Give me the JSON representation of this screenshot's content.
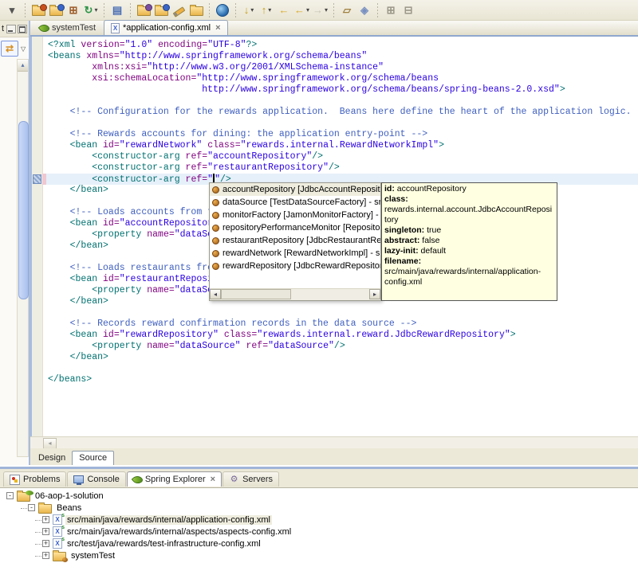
{
  "colors": {
    "window_bg": "#ECE9D8",
    "accent_blue": "#9FB4D8",
    "current_line": "#E6F0FA",
    "selection_bg": "#EFEDDE",
    "tooltip_bg": "#FFFFE1",
    "syntax": {
      "tag": "#007070",
      "attr": "#7F007F",
      "value": "#2A00E2",
      "comment": "#3F5FBF",
      "text": "#000000"
    }
  },
  "toolbar": {
    "items": [
      {
        "k": "glyph",
        "name": "menu-dropdown-icon",
        "glyph": "▾",
        "color": "#555555"
      },
      {
        "k": "sep"
      },
      {
        "k": "folder",
        "name": "new-wizard-icon",
        "badge": "#C8501E"
      },
      {
        "k": "folder",
        "name": "new-java-project-icon",
        "badge": "#3A66C8"
      },
      {
        "k": "glyph",
        "name": "new-package-icon",
        "glyph": "⊞",
        "color": "#9C5A28"
      },
      {
        "k": "glyph",
        "name": "refresh-icon",
        "glyph": "↻",
        "color": "#2C9447",
        "dd": true
      },
      {
        "k": "sep"
      },
      {
        "k": "glyph",
        "name": "new-document-icon",
        "glyph": "▤",
        "color": "#4A6FB5"
      },
      {
        "k": "sep"
      },
      {
        "k": "folder",
        "name": "open-wizard-icon",
        "badge": "#7B4FA0"
      },
      {
        "k": "folder",
        "name": "open-resource-icon",
        "badge": "#3A66C8"
      },
      {
        "k": "pencil",
        "name": "brush-icon"
      },
      {
        "k": "folder",
        "name": "open-file-icon"
      },
      {
        "k": "sep"
      },
      {
        "k": "globe",
        "name": "web-browser-icon"
      },
      {
        "k": "sep"
      },
      {
        "k": "glyph",
        "name": "import-icon",
        "glyph": "↓",
        "color": "#C8A018",
        "dd": true
      },
      {
        "k": "glyph",
        "name": "export-icon",
        "glyph": "↑",
        "color": "#C8A018",
        "dd": true
      },
      {
        "k": "glyph",
        "name": "back-to-last-edit-icon",
        "glyph": "←",
        "color": "#D8A820"
      },
      {
        "k": "glyph",
        "name": "back-icon",
        "glyph": "←",
        "color": "#D8A820",
        "dd": true
      },
      {
        "k": "glyph",
        "name": "forward-icon",
        "glyph": "→",
        "color": "#C9C5B4",
        "dd": true
      },
      {
        "k": "sep"
      },
      {
        "k": "glyph",
        "name": "last-edit-location-icon",
        "glyph": "▱",
        "color": "#A08040"
      },
      {
        "k": "glyph",
        "name": "annotation-icon",
        "glyph": "◈",
        "color": "#7890C0"
      },
      {
        "k": "sep"
      },
      {
        "k": "glyph",
        "name": "expand-all-icon",
        "glyph": "⊞",
        "color": "#9A9688"
      },
      {
        "k": "glyph",
        "name": "collapse-all-icon",
        "glyph": "⊟",
        "color": "#9A9688"
      }
    ]
  },
  "left_panel": {
    "tab_stub": "t",
    "link_glyph": "⇄",
    "dropdown_glyph": "▽",
    "scroll_up_glyph": "▴"
  },
  "editor_tabs": [
    {
      "label": "systemTest",
      "icon": "spring-leaf-icon"
    },
    {
      "label": "*application-config.xml",
      "icon": "xml-file-icon",
      "active": true,
      "close": "×"
    }
  ],
  "editor": {
    "lines": [
      {
        "i": 0,
        "s": [
          [
            "t",
            "<?xml "
          ],
          [
            "a",
            "version="
          ],
          [
            "v",
            "\"1.0\""
          ],
          [
            "p",
            " "
          ],
          [
            "a",
            "encoding="
          ],
          [
            "v",
            "\"UTF-8\""
          ],
          [
            "t",
            "?>"
          ]
        ]
      },
      {
        "i": 0,
        "s": [
          [
            "t",
            "<beans "
          ],
          [
            "a",
            "xmlns="
          ],
          [
            "v",
            "\"http://www.springframework.org/schema/beans\""
          ]
        ]
      },
      {
        "i": 8,
        "s": [
          [
            "a",
            "xmlns:xsi="
          ],
          [
            "v",
            "\"http://www.w3.org/2001/XMLSchema-instance\""
          ]
        ]
      },
      {
        "i": 8,
        "s": [
          [
            "a",
            "xsi:schemaLocation="
          ],
          [
            "v",
            "\"http://www.springframework.org/schema/beans"
          ]
        ]
      },
      {
        "i": 28,
        "s": [
          [
            "v",
            "http://www.springframework.org/schema/beans/spring-beans-2.0.xsd\""
          ],
          [
            "t",
            ">"
          ]
        ]
      },
      {
        "i": 0,
        "s": []
      },
      {
        "i": 4,
        "s": [
          [
            "c",
            "<!-- Configuration for the rewards application.  Beans here define the heart of the application logic. -->"
          ]
        ]
      },
      {
        "i": 0,
        "s": []
      },
      {
        "i": 4,
        "s": [
          [
            "c",
            "<!-- Rewards accounts for dining: the application entry-point -->"
          ]
        ]
      },
      {
        "i": 4,
        "s": [
          [
            "t",
            "<bean "
          ],
          [
            "a",
            "id="
          ],
          [
            "v",
            "\"rewardNetwork\""
          ],
          [
            "p",
            " "
          ],
          [
            "a",
            "class="
          ],
          [
            "v",
            "\"rewards.internal.RewardNetworkImpl\""
          ],
          [
            "t",
            ">"
          ]
        ]
      },
      {
        "i": 8,
        "s": [
          [
            "t",
            "<constructor-arg "
          ],
          [
            "a",
            "ref="
          ],
          [
            "v",
            "\"accountRepository\""
          ],
          [
            "t",
            "/>"
          ]
        ]
      },
      {
        "i": 8,
        "s": [
          [
            "t",
            "<constructor-arg "
          ],
          [
            "a",
            "ref="
          ],
          [
            "v",
            "\"restaurantRepository\""
          ],
          [
            "t",
            "/>"
          ]
        ]
      },
      {
        "i": 8,
        "cur": true,
        "s": [
          [
            "t",
            "<constructor-arg "
          ],
          [
            "a",
            "ref="
          ],
          [
            "v",
            "\""
          ],
          [
            "caret",
            ""
          ],
          [
            "v",
            "\""
          ],
          [
            "t",
            "/>"
          ]
        ]
      },
      {
        "i": 4,
        "s": [
          [
            "t",
            "</bean>"
          ]
        ]
      },
      {
        "i": 0,
        "s": []
      },
      {
        "i": 4,
        "s": [
          [
            "c",
            "<!-- Loads accounts from t"
          ]
        ]
      },
      {
        "i": 4,
        "s": [
          [
            "t",
            "<bean "
          ],
          [
            "a",
            "id="
          ],
          [
            "v",
            "\"accountRepositor"
          ]
        ]
      },
      {
        "i": 8,
        "s": [
          [
            "t",
            "<property "
          ],
          [
            "a",
            "name="
          ],
          [
            "v",
            "\"dataSo"
          ]
        ]
      },
      {
        "i": 4,
        "s": [
          [
            "t",
            "</bean>"
          ]
        ]
      },
      {
        "i": 0,
        "s": []
      },
      {
        "i": 4,
        "s": [
          [
            "c",
            "<!-- Loads restaurants fro"
          ]
        ]
      },
      {
        "i": 4,
        "s": [
          [
            "t",
            "<bean "
          ],
          [
            "a",
            "id="
          ],
          [
            "v",
            "\"restaurantReposi"
          ]
        ]
      },
      {
        "i": 8,
        "s": [
          [
            "t",
            "<property "
          ],
          [
            "a",
            "name="
          ],
          [
            "v",
            "\"dataSo"
          ]
        ]
      },
      {
        "i": 4,
        "s": [
          [
            "t",
            "</bean>"
          ]
        ]
      },
      {
        "i": 0,
        "s": []
      },
      {
        "i": 4,
        "s": [
          [
            "c",
            "<!-- Records reward confirmation records in the data source -->"
          ]
        ]
      },
      {
        "i": 4,
        "s": [
          [
            "t",
            "<bean "
          ],
          [
            "a",
            "id="
          ],
          [
            "v",
            "\"rewardRepository\""
          ],
          [
            "p",
            " "
          ],
          [
            "a",
            "class="
          ],
          [
            "v",
            "\"rewards.internal.reward.JdbcRewardRepository\""
          ],
          [
            "t",
            ">"
          ]
        ]
      },
      {
        "i": 8,
        "s": [
          [
            "t",
            "<property "
          ],
          [
            "a",
            "name="
          ],
          [
            "v",
            "\"dataSource\""
          ],
          [
            "p",
            " "
          ],
          [
            "a",
            "ref="
          ],
          [
            "v",
            "\"dataSource\""
          ],
          [
            "t",
            "/>"
          ]
        ]
      },
      {
        "i": 4,
        "s": [
          [
            "t",
            "</bean>"
          ]
        ]
      },
      {
        "i": 0,
        "s": []
      },
      {
        "i": 0,
        "s": [
          [
            "t",
            "</beans>"
          ]
        ]
      }
    ]
  },
  "completion_popup": {
    "items": [
      {
        "label": "accountRepository [JdbcAccountRepository] - src",
        "selected": true
      },
      {
        "label": "dataSource [TestDataSourceFactory] - src/test/ja"
      },
      {
        "label": "monitorFactory [JamonMonitorFactory] - src/main"
      },
      {
        "label": "repositoryPerformanceMonitor [RepositoryPerfor"
      },
      {
        "label": "restaurantRepository [JdbcRestaurantRepository"
      },
      {
        "label": "rewardNetwork [RewardNetworkImpl] - src/main/j"
      },
      {
        "label": "rewardRepository [JdbcRewardRepository] - src/r"
      }
    ],
    "scroll_left_glyph": "◂",
    "scroll_right_glyph": "▸"
  },
  "tooltip": {
    "rows": [
      {
        "label": "id:",
        "value": "accountRepository"
      },
      {
        "label": "class:",
        "value": "rewards.internal.account.JdbcAccountRepository"
      },
      {
        "label": "singleton:",
        "value": "true"
      },
      {
        "label": "abstract:",
        "value": "false"
      },
      {
        "label": "lazy-init:",
        "value": "default"
      },
      {
        "label": "filename:",
        "value": "src/main/java/rewards/internal/application-config.xml"
      }
    ]
  },
  "hscroll": {
    "left_glyph": "◂"
  },
  "view_tabs": [
    {
      "label": "Design"
    },
    {
      "label": "Source",
      "active": true
    }
  ],
  "bottom_tabs": [
    {
      "label": "Problems",
      "icon": "problems-icon"
    },
    {
      "label": "Console",
      "icon": "console-icon"
    },
    {
      "label": "Spring Explorer",
      "icon": "spring-leaf-icon",
      "active": true,
      "close": "×"
    },
    {
      "label": "Servers",
      "icon": "servers-icon"
    }
  ],
  "tree": {
    "items": [
      {
        "level": 0,
        "expander": "-",
        "icon": "spring-project-folder-icon",
        "label": "06-aop-1-solution"
      },
      {
        "level": 1,
        "expander": "-",
        "icon": "beans-folder-icon",
        "label": "Beans"
      },
      {
        "level": 2,
        "expander": "+",
        "icon": "spring-config-file-icon",
        "label": "src/main/java/rewards/internal/application-config.xml",
        "selected": true
      },
      {
        "level": 2,
        "expander": "+",
        "icon": "spring-config-file-icon",
        "label": "src/main/java/rewards/internal/aspects/aspects-config.xml"
      },
      {
        "level": 2,
        "expander": "+",
        "icon": "spring-config-file-icon",
        "label": "src/test/java/rewards/test-infrastructure-config.xml"
      },
      {
        "level": 2,
        "expander": "+",
        "icon": "config-set-folder-icon",
        "label": "systemTest"
      }
    ]
  }
}
